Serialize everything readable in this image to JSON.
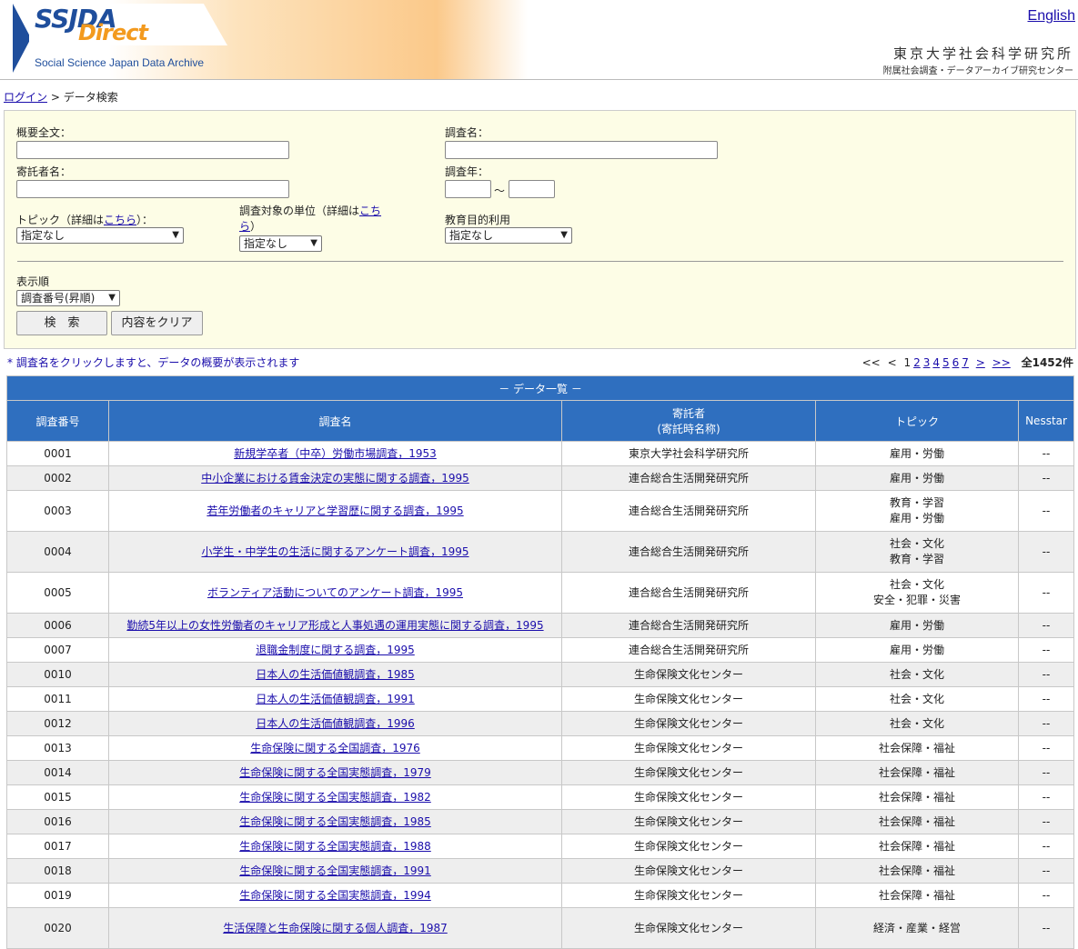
{
  "header": {
    "logo_main": "SSJDA",
    "logo_direct": "Direct",
    "logo_sub": "Social Science Japan Data Archive",
    "english_link": "English",
    "institute": "東京大学社会科学研究所",
    "institute_sub": "附属社会調査・データアーカイブ研究センター"
  },
  "breadcrumb": {
    "login": "ログイン",
    "sep": " > ",
    "current": "データ検索"
  },
  "search": {
    "abstract_label": "概要全文：",
    "title_label": "調査名：",
    "depositor_label": "寄託者名：",
    "year_label": "調査年：",
    "year_sep": "～",
    "topic_label_pre": "トピック（詳細は",
    "topic_label_link": "こちら",
    "topic_label_post": "）：",
    "topic_value": "指定なし",
    "unit_label_pre": "調査対象の単位（詳細は",
    "unit_label_link1": "こち",
    "unit_label_link2": "ら",
    "unit_label_post": "）",
    "unit_value": "指定なし",
    "edu_label": "教育目的利用",
    "edu_value": "指定なし",
    "order_label": "表示順",
    "order_value": "調査番号(昇順)",
    "search_button": "検　索",
    "clear_button": "内容をクリア"
  },
  "note": "* 調査名をクリックしますと、データの概要が表示されます",
  "pager": {
    "first": "<<",
    "prev": "<",
    "current": "1",
    "pages": [
      "2",
      "3",
      "4",
      "5",
      "6",
      "7"
    ],
    "next": ">",
    "last": ">>",
    "total": "全1452件"
  },
  "table": {
    "caption": "－ データ一覧 －",
    "headers": {
      "id": "調査番号",
      "title": "調査名",
      "depositor_1": "寄託者",
      "depositor_2": "(寄託時名称)",
      "topic": "トピック",
      "nesstar": "Nesstar"
    },
    "rows": [
      {
        "id": "0001",
        "title": "新規学卒者（中卒）労働市場調査，1953",
        "depositor": "東京大学社会科学研究所",
        "topics": [
          "雇用・労働"
        ],
        "nesstar": "--"
      },
      {
        "id": "0002",
        "title": "中小企業における賃金決定の実態に関する調査，1995",
        "depositor": "連合総合生活開発研究所",
        "topics": [
          "雇用・労働"
        ],
        "nesstar": "--"
      },
      {
        "id": "0003",
        "title": "若年労働者のキャリアと学習歴に関する調査，1995",
        "depositor": "連合総合生活開発研究所",
        "topics": [
          "教育・学習",
          "雇用・労働"
        ],
        "nesstar": "--"
      },
      {
        "id": "0004",
        "title": "小学生・中学生の生活に関するアンケート調査，1995",
        "depositor": "連合総合生活開発研究所",
        "topics": [
          "社会・文化",
          "教育・学習"
        ],
        "nesstar": "--"
      },
      {
        "id": "0005",
        "title": "ボランティア活動についてのアンケート調査，1995",
        "depositor": "連合総合生活開発研究所",
        "topics": [
          "社会・文化",
          "安全・犯罪・災害"
        ],
        "nesstar": "--"
      },
      {
        "id": "0006",
        "title": "勤続5年以上の女性労働者のキャリア形成と人事処遇の運用実態に関する調査，1995",
        "depositor": "連合総合生活開発研究所",
        "topics": [
          "雇用・労働"
        ],
        "nesstar": "--"
      },
      {
        "id": "0007",
        "title": "退職金制度に関する調査，1995",
        "depositor": "連合総合生活開発研究所",
        "topics": [
          "雇用・労働"
        ],
        "nesstar": "--"
      },
      {
        "id": "0010",
        "title": "日本人の生活価値観調査，1985",
        "depositor": "生命保険文化センター",
        "topics": [
          "社会・文化"
        ],
        "nesstar": "--"
      },
      {
        "id": "0011",
        "title": "日本人の生活価値観調査，1991",
        "depositor": "生命保険文化センター",
        "topics": [
          "社会・文化"
        ],
        "nesstar": "--"
      },
      {
        "id": "0012",
        "title": "日本人の生活価値観調査，1996",
        "depositor": "生命保険文化センター",
        "topics": [
          "社会・文化"
        ],
        "nesstar": "--"
      },
      {
        "id": "0013",
        "title": "生命保険に関する全国調査，1976",
        "depositor": "生命保険文化センター",
        "topics": [
          "社会保障・福祉"
        ],
        "nesstar": "--"
      },
      {
        "id": "0014",
        "title": "生命保険に関する全国実態調査，1979",
        "depositor": "生命保険文化センター",
        "topics": [
          "社会保障・福祉"
        ],
        "nesstar": "--"
      },
      {
        "id": "0015",
        "title": "生命保険に関する全国実態調査，1982",
        "depositor": "生命保険文化センター",
        "topics": [
          "社会保障・福祉"
        ],
        "nesstar": "--"
      },
      {
        "id": "0016",
        "title": "生命保険に関する全国実態調査，1985",
        "depositor": "生命保険文化センター",
        "topics": [
          "社会保障・福祉"
        ],
        "nesstar": "--"
      },
      {
        "id": "0017",
        "title": "生命保険に関する全国実態調査，1988",
        "depositor": "生命保険文化センター",
        "topics": [
          "社会保障・福祉"
        ],
        "nesstar": "--"
      },
      {
        "id": "0018",
        "title": "生命保険に関する全国実態調査，1991",
        "depositor": "生命保険文化センター",
        "topics": [
          "社会保障・福祉"
        ],
        "nesstar": "--"
      },
      {
        "id": "0019",
        "title": "生命保険に関する全国実態調査，1994",
        "depositor": "生命保険文化センター",
        "topics": [
          "社会保障・福祉"
        ],
        "nesstar": "--"
      },
      {
        "id": "0020",
        "title": "生活保障と生命保険に関する個人調査，1987",
        "depositor": "生命保険文化センター",
        "topics": [
          "経済・産業・経営",
          ""
        ],
        "nesstar": "--"
      }
    ]
  }
}
